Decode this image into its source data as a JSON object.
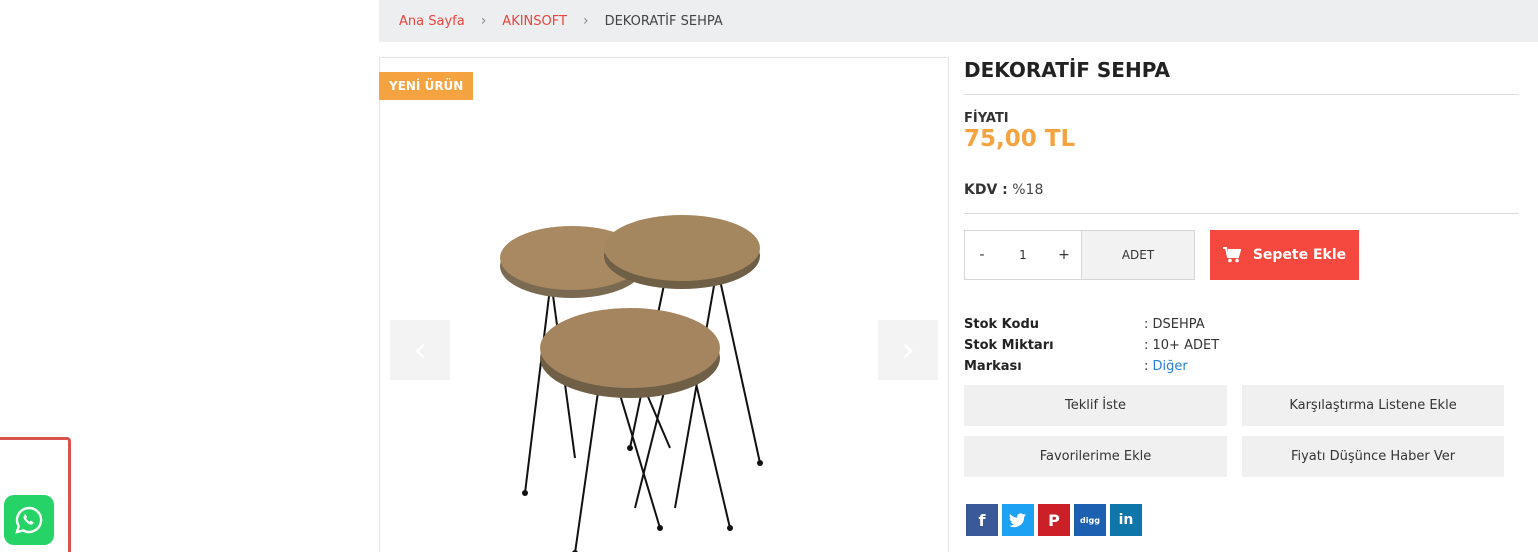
{
  "breadcrumb": {
    "home": "Ana Sayfa",
    "category": "AKINSOFT",
    "current": "DEKORATİF SEHPA"
  },
  "gallery": {
    "badge": "YENİ ÜRÜN"
  },
  "product": {
    "title": "DEKORATİF SEHPA",
    "price_label": "FİYATI",
    "price": "75,00 TL",
    "kdv_label": "KDV :",
    "kdv_value": "%18"
  },
  "cart": {
    "minus": "-",
    "quantity": "1",
    "plus": "+",
    "unit": "ADET",
    "add_label": "Sepete Ekle"
  },
  "specs": [
    {
      "key": "Stok Kodu",
      "value": ": DSEHPA"
    },
    {
      "key": "Stok Miktarı",
      "value": ": 10+ ADET"
    },
    {
      "key": "Markası",
      "sep": ": ",
      "value": "Diğer"
    }
  ],
  "actions": {
    "quote": "Teklif İste",
    "compare": "Karşılaştırma Listene Ekle",
    "favorites": "Favorilerime Ekle",
    "price_alert": "Fiyatı Düşünce Haber Ver"
  },
  "social": {
    "facebook": "f",
    "twitter": "t",
    "pinterest": "P",
    "digg": "digg",
    "linkedin": "in"
  },
  "colors": {
    "accent_red": "#f5493f",
    "price_orange": "#f4a340",
    "link_blue": "#2a7fd4",
    "whatsapp_green": "#25d366"
  },
  "icons": [
    "chevron-left-icon",
    "chevron-right-icon",
    "cart-icon",
    "whatsapp-icon"
  ]
}
